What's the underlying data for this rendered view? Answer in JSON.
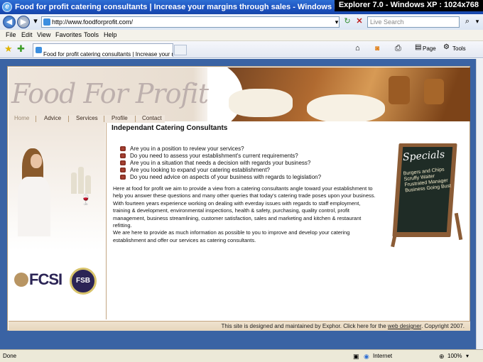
{
  "window": {
    "title": "Food for profit catering consultants | Increase your margins through sales - Windows Internet Explorer",
    "overlay": "Explorer 7.0 - Windows XP : 1024x768"
  },
  "address_bar": {
    "url": "http://www.foodforprofit.com/",
    "search_placeholder": "Live Search"
  },
  "menu": [
    "File",
    "Edit",
    "View",
    "Favorites",
    "Tools",
    "Help"
  ],
  "tab": {
    "title": "Food for profit catering consultants | Increase your m..."
  },
  "toolbar": {
    "page_label": "Page",
    "tools_label": "Tools"
  },
  "site": {
    "logo": "Food For Profit",
    "nav": [
      "Home",
      "Advice",
      "Services",
      "Profile",
      "Contact"
    ],
    "heading": "Independant Catering Consultants",
    "bullets": [
      "Are you in a position to review your services?",
      "Do you need to assess your establishment's current requirements?",
      "Are you in a situation that needs a decision with regards your business?",
      "Are you looking to expand your catering establishment?",
      "Do you need advice on aspects of your business with regards to legislation?"
    ],
    "paragraph1": "Here at food for profit we aim to provide a view from a catering consultants angle toward your establishment to help you answer these questions and many other queries that today's catering trade poses upon your business. With fourteen years experience working on dealing with everday issues with regards to staff employment, training & development, environmental inspections, health & safety, purchasing, quality control, profit management, business streamlining, customer satisfaction, sales and marketing and kitchen & restaurant refitting.",
    "paragraph2": "We are here to provide as much information as possible to you to improve and develop your catering establishment and offer our services as catering consultants.",
    "specials_title": "Specials",
    "specials_text": "Burgers and Chips Scruffy Waiter Frustrated Manager Business Going Bust",
    "logos": {
      "fcsi": "FCSI",
      "fsb": "FSB"
    },
    "footer_prefix": "This site is designed and maintained by Exphor. Click here for the ",
    "footer_link": "web designer",
    "footer_suffix": ". Copyright 2007."
  },
  "status": {
    "left": "Done",
    "zone": "Internet",
    "zoom": "100%"
  }
}
